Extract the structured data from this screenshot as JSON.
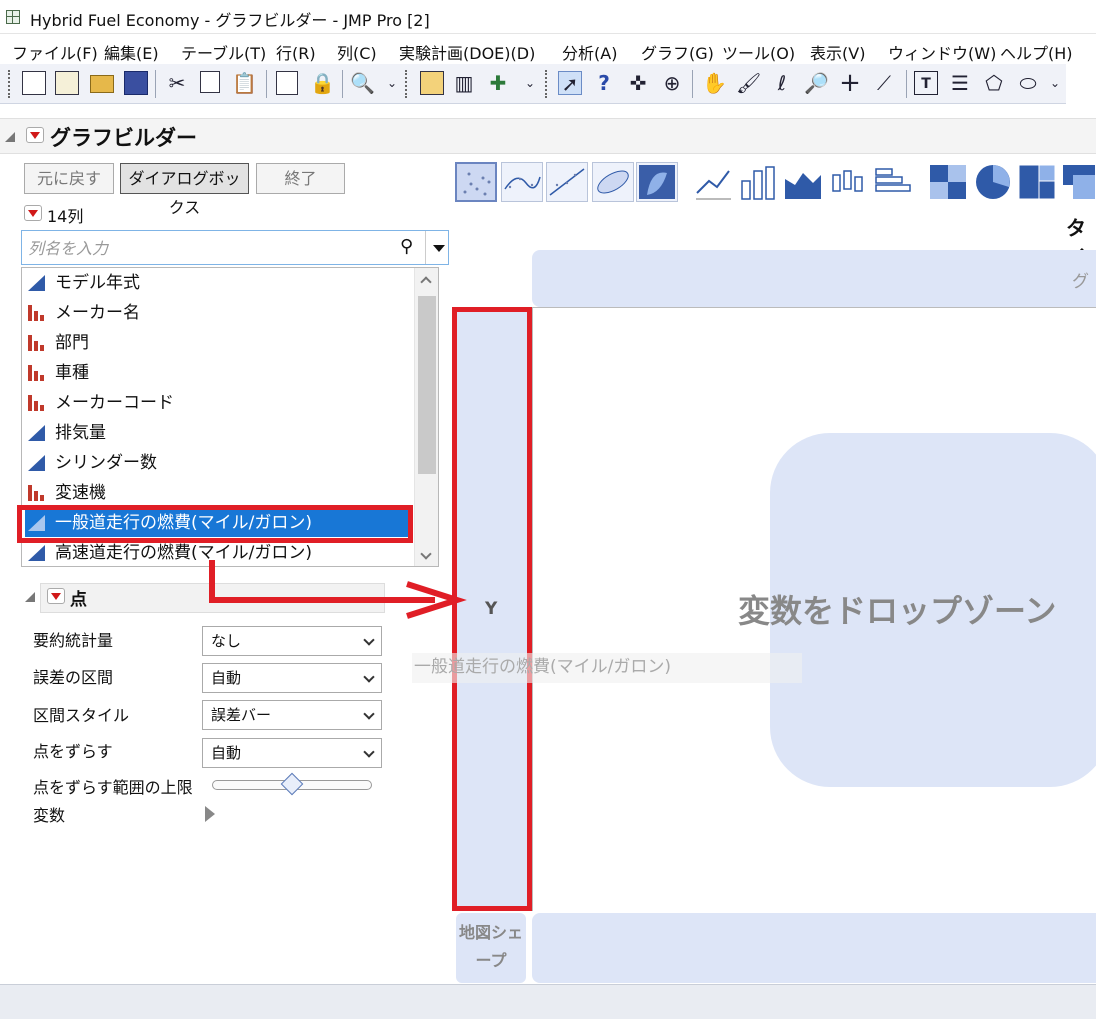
{
  "window": {
    "title": "Hybrid Fuel Economy - グラフビルダー - JMP Pro [2]"
  },
  "menu": [
    "ファイル(F)",
    "編集(E)",
    "テーブル(T)",
    "行(R)",
    "列(C)",
    "実験計画(DOE)(D)",
    "分析(A)",
    "グラフ(G)",
    "ツール(O)",
    "表示(V)",
    "ウィンドウ(W)",
    "ヘルプ(H)"
  ],
  "graph_builder": {
    "title": "グラフビルダー",
    "buttons": {
      "undo": "元に戻す",
      "dialog": "ダイアログボックス",
      "finish": "終了"
    },
    "column_count": "14列",
    "search_placeholder": "列名を入力",
    "columns": [
      {
        "name": "モデル年式",
        "type": "continuous"
      },
      {
        "name": "メーカー名",
        "type": "nominal"
      },
      {
        "name": "部門",
        "type": "nominal"
      },
      {
        "name": "車種",
        "type": "nominal"
      },
      {
        "name": "メーカーコード",
        "type": "nominal"
      },
      {
        "name": "排気量",
        "type": "continuous"
      },
      {
        "name": "シリンダー数",
        "type": "continuous"
      },
      {
        "name": "変速機",
        "type": "nominal"
      },
      {
        "name": "一般道走行の燃費(マイル/ガロン)",
        "type": "continuous",
        "selected": true
      },
      {
        "name": "高速道走行の燃費(マイル/ガロン)",
        "type": "continuous"
      }
    ],
    "points_section": {
      "title": "点",
      "rows": [
        {
          "label": "要約統計量",
          "value": "なし"
        },
        {
          "label": "誤差の区間",
          "value": "自動"
        },
        {
          "label": "区間スタイル",
          "value": "誤差バー"
        },
        {
          "label": "点をずらす",
          "value": "自動"
        }
      ],
      "jitter_limit_label": "点をずらす範囲の上限",
      "variable_label": "変数"
    }
  },
  "graph": {
    "title_zone": "グ",
    "title_top": "タイ",
    "y_zone": "Y",
    "drop_message": "変数をドロップゾーン",
    "dragging_label": "一般道走行の燃費(マイル/ガロン)",
    "map_shape": "地図シェープ"
  },
  "colors": {
    "selection": "#1877d6",
    "highlight": "#e01e26",
    "dropzone": "#dde5f7"
  }
}
